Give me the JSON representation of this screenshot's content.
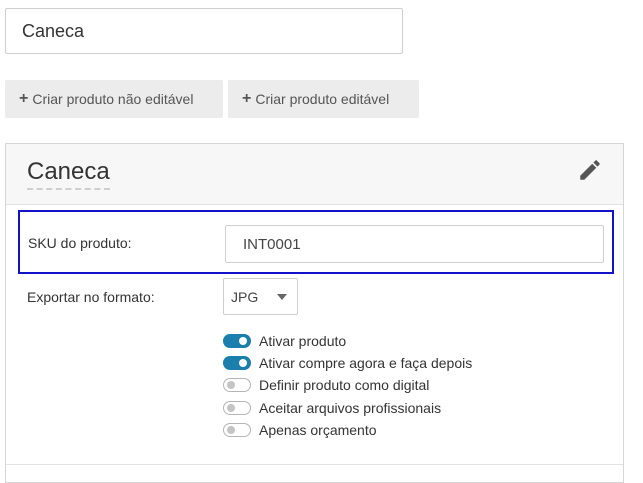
{
  "product_name_input": {
    "value": "Caneca"
  },
  "buttons": {
    "create_non_editable": "Criar produto não editável",
    "create_editable": "Criar produto editável"
  },
  "panel": {
    "title": "Caneca",
    "edit_icon": "pencil-icon",
    "sku": {
      "label": "SKU do produto:",
      "value": "INT0001"
    },
    "export": {
      "label": "Exportar no formato:",
      "selected": "JPG"
    },
    "toggles": [
      {
        "label": "Ativar produto",
        "on": true
      },
      {
        "label": "Ativar compre agora e faça depois",
        "on": true
      },
      {
        "label": "Definir produto como digital",
        "on": false
      },
      {
        "label": "Aceitar arquivos profissionais",
        "on": false
      },
      {
        "label": "Apenas orçamento",
        "on": false
      }
    ]
  },
  "colors": {
    "highlight_border": "#1212c8",
    "toggle_on": "#1a7fad"
  }
}
